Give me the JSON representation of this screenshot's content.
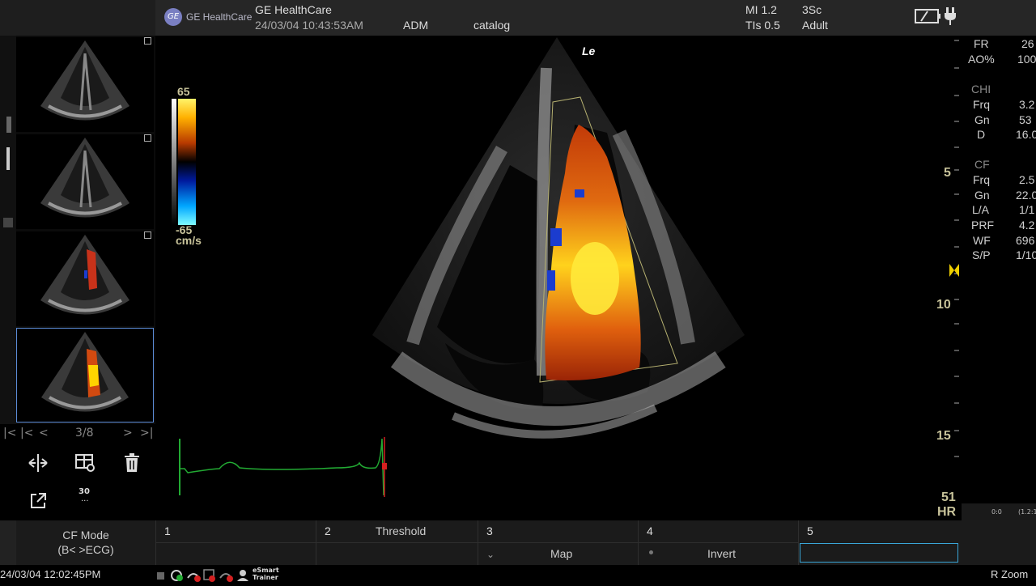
{
  "header": {
    "brand_logo_text": "GE",
    "brand_name": "GE HealthCare",
    "title": "GE HealthCare",
    "datetime": "24/03/04 10:43:53AM",
    "operator": "ADM",
    "preset": "catalog",
    "mi": "MI 1.2",
    "tis": "TIs 0.5",
    "probe": "3Sc",
    "patient_type": "Adult"
  },
  "thumbnails": {
    "nav": {
      "first": "|<",
      "prev_page": "|<",
      "prev": "<",
      "counter": "3/8",
      "next": ">",
      "last": ">|"
    },
    "count_badge": "30",
    "count_badge_sub": "..."
  },
  "color_scale": {
    "max": "65",
    "min": "-65",
    "unit": "cm/s"
  },
  "image_label": "Le",
  "params": {
    "fr": {
      "label": "FR",
      "value": "26"
    },
    "ao": {
      "label": "AO%",
      "value": "100"
    },
    "chi_header": "CHI",
    "chi": [
      {
        "label": "Frq",
        "value": "3.2"
      },
      {
        "label": "Gn",
        "value": "53"
      },
      {
        "label": "D",
        "value": "16.0"
      }
    ],
    "cf_header": "CF",
    "cf": [
      {
        "label": "Frq",
        "value": "2.5"
      },
      {
        "label": "Gn",
        "value": "22.0"
      },
      {
        "label": "L/A",
        "value": "1/1"
      },
      {
        "label": "PRF",
        "value": "4.2"
      },
      {
        "label": "WF",
        "value": "696"
      },
      {
        "label": "S/P",
        "value": "1/10"
      }
    ]
  },
  "depth_scale": [
    "5",
    "10",
    "15"
  ],
  "hr": {
    "value": "51",
    "label": "HR"
  },
  "mini_scale": {
    "left": "0:0",
    "right": "(1.2:1"
  },
  "softkeys": {
    "mode_title": "CF Mode",
    "mode_sub": "(B< >ECG)",
    "keys": [
      {
        "num": "1",
        "top": "",
        "bottom": ""
      },
      {
        "num": "2",
        "top": "Threshold",
        "bottom": ""
      },
      {
        "num": "3",
        "top": "",
        "bottom": "Map"
      },
      {
        "num": "4",
        "top": "",
        "bottom": "Invert"
      },
      {
        "num": "5",
        "top": "",
        "bottom": ""
      }
    ]
  },
  "status": {
    "datetime": "24/03/04 12:02:45PM",
    "esmart_line1": "eSmart",
    "esmart_line2": "Trainer",
    "right_label": "R Zoom"
  }
}
